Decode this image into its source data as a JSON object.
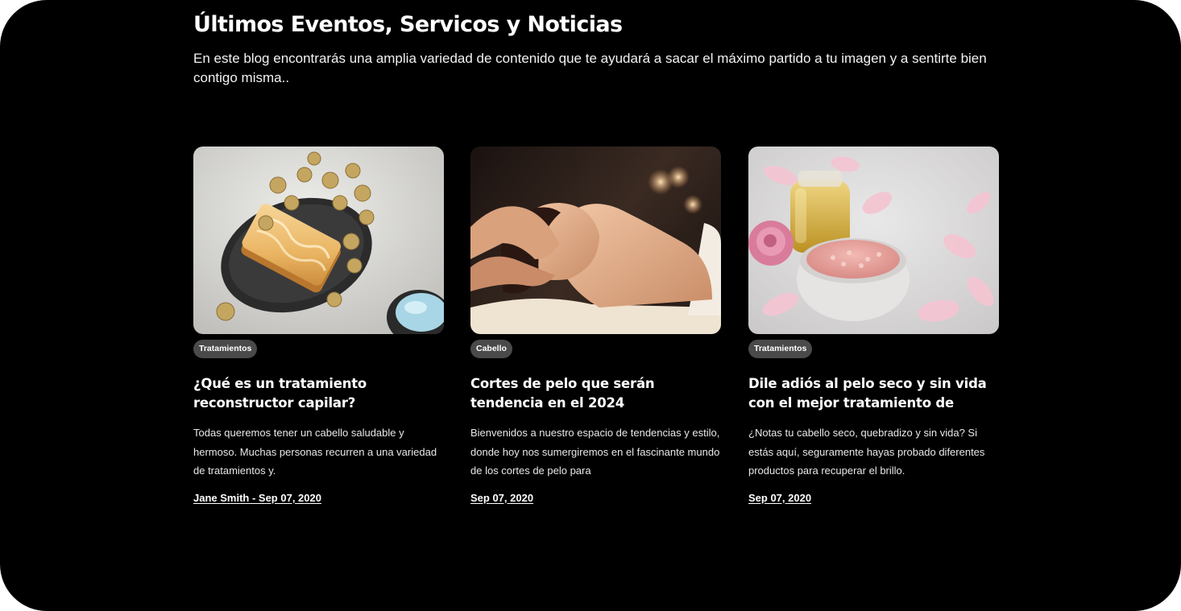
{
  "section": {
    "title": "Últimos Eventos, Servicos y Noticias",
    "description": "En este blog encontrarás una amplia variedad de contenido que te ayudará a sacar el máximo partido a tu imagen y a sentirte bien contigo misma.."
  },
  "colors": {
    "background": "#000000",
    "badge": "#4a4a4a",
    "text": "#ffffff"
  },
  "posts": [
    {
      "image": "soap-bar-with-dried-roses-photo",
      "category": "Tratamientos",
      "title": "¿Qué es un tratamiento reconstructor capilar?",
      "excerpt": "Todas queremos tener un cabello saludable y hermoso. Muchas personas recurren a una variedad de tratamientos y.",
      "meta": "Jane Smith - Sep 07, 2020"
    },
    {
      "image": "woman-receiving-head-massage-photo",
      "category": "Cabello",
      "title": "Cortes de pelo que serán tendencia en el 2024",
      "excerpt": "Bienvenidos a nuestro espacio de tendencias y estilo, donde hoy nos sumergiremos en el fascinante mundo de los cortes de pelo para",
      "meta": "Sep 07, 2020"
    },
    {
      "image": "oil-bottle-and-pink-salt-with-rose-petals-photo",
      "category": "Tratamientos",
      "title": "Dile adiós al pelo seco y sin vida con el mejor tratamiento de",
      "excerpt": "¿Notas tu cabello seco, quebradizo y sin vida? Si estás aquí, seguramente hayas probado diferentes productos para recuperar el brillo.",
      "meta": "Sep 07, 2020"
    }
  ]
}
